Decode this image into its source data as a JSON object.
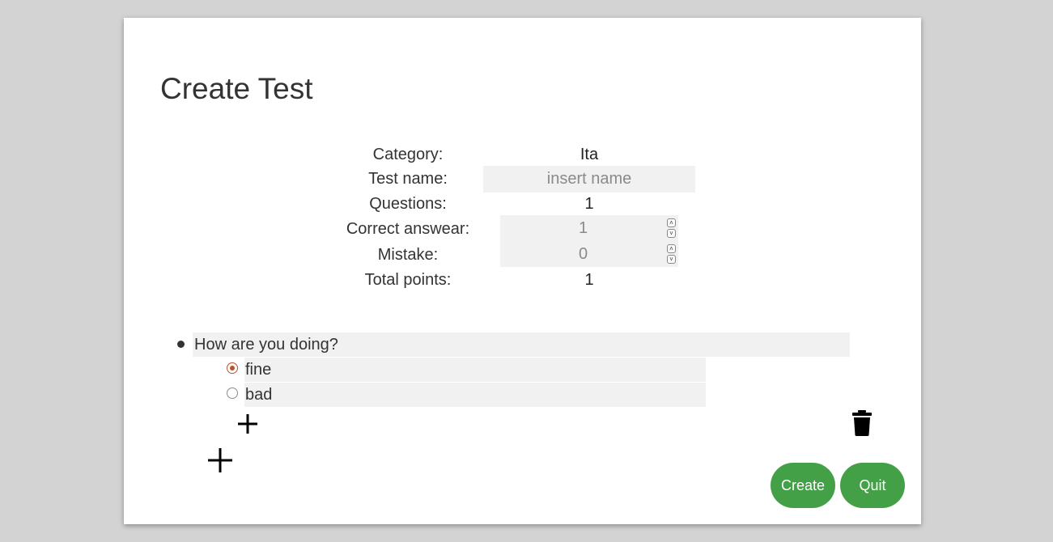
{
  "page": {
    "title": "Create Test"
  },
  "form": {
    "category_label": "Category:",
    "category_value": "Ita",
    "test_name_label": "Test name:",
    "test_name_placeholder": "insert name",
    "test_name_value": "",
    "questions_label": "Questions:",
    "questions_value": "1",
    "correct_label": "Correct answear:",
    "correct_value": "1",
    "mistake_label": "Mistake:",
    "mistake_value": "0",
    "total_label": "Total points:",
    "total_value": "1"
  },
  "questions": [
    {
      "text": "How are you doing?",
      "answers": [
        {
          "text": "fine",
          "selected": true
        },
        {
          "text": "bad",
          "selected": false
        }
      ]
    }
  ],
  "icons": {
    "add_answer": "plus-icon",
    "add_question": "plus-icon",
    "delete_question": "trash-icon",
    "spinner_up": "chevron-up-icon",
    "spinner_down": "chevron-down-icon"
  },
  "buttons": {
    "create": "Create",
    "quit": "Quit"
  },
  "colors": {
    "accent": "#43a047",
    "radio_selected": "#c0502c",
    "field_bg": "#f1f1f1"
  }
}
